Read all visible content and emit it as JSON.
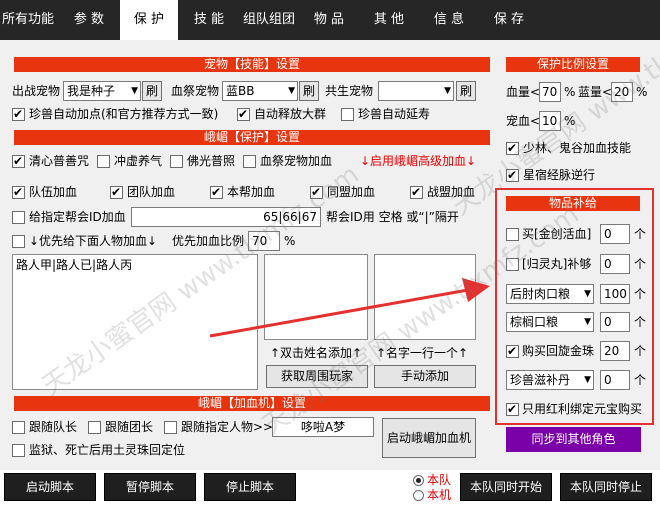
{
  "tabs": [
    "所有功能",
    "参 数",
    "保 护",
    "技 能",
    "组队组团",
    "物 品",
    "其 他",
    "信 息",
    "保 存"
  ],
  "active_tab": "保 护",
  "pet": {
    "header": "宠物【技能】设置",
    "battle_pet_label": "出战宠物",
    "battle_pet_value": "我是种子",
    "blood_pet_label": "血祭宠物",
    "blood_pet_value": "蓝BB",
    "cobirth_pet_label": "共生宠物",
    "cobirth_pet_value": "",
    "refresh_label": "刷",
    "auto_addpoint": "珍兽自动加点(和官方推荐方式一致)",
    "auto_release_group": "自动释放大群",
    "auto_extend": "珍兽自动延寿"
  },
  "protect": {
    "header": "峨嵋【保护】设置",
    "items": [
      "清心普善咒",
      "冲虚养气",
      "佛光普照",
      "血祭宠物加血"
    ],
    "emei_advanced": "↓启用峨嵋高级加血↓",
    "heal_items": [
      "队伍加血",
      "团队加血",
      "本帮加血",
      "同盟加血",
      "战盟加血"
    ],
    "guild_id_label": "给指定帮会ID加血",
    "guild_id_value": "65|66|67",
    "guild_id_hint": "帮会ID用 空格 或“|”隔开",
    "priority_label": "↓优先给下面人物加血↓",
    "priority_ratio_label": "优先加血比例",
    "priority_ratio_value": "70",
    "percent": "%",
    "names_text": "路人甲|路人已|路人丙",
    "double_click_hint": "↑双击姓名添加↑",
    "one_per_line_hint": "↑名字一行一个↑",
    "get_players_btn": "获取周围玩家",
    "manual_add_btn": "手动添加"
  },
  "addmachine": {
    "header": "峨嵋【加血机】设置",
    "follow_leader": "跟随队长",
    "follow_group_leader": "跟随团长",
    "follow_person": "跟随指定人物>>>",
    "follow_person_value": "哆啦A梦",
    "prison_label": "监狱、死亡后用土灵珠回定位",
    "start_btn": "启动峨嵋加血机"
  },
  "ratio": {
    "header": "保护比例设置",
    "hp_label": "血量<",
    "hp_value": "70",
    "mp_label": "蓝量<",
    "mp_value": "20",
    "pet_label": "宠血<",
    "pet_value": "10",
    "percent": "%",
    "shaolin_label": "少林、鬼谷加血技能",
    "star_label": "星宿经脉逆行"
  },
  "supply": {
    "header": "物品补给",
    "rows": [
      {
        "type": "checkbox",
        "label": "买[金创活血]",
        "qty": "0"
      },
      {
        "type": "checkbox",
        "label": "[归灵丸]补够",
        "qty": "0"
      },
      {
        "type": "select",
        "label": "后肘肉口粮",
        "qty": "100"
      },
      {
        "type": "select",
        "label": "棕榈口粮",
        "qty": "0"
      },
      {
        "type": "checkbox",
        "label": "购买回旋金珠",
        "qty": "20"
      },
      {
        "type": "select",
        "label": "珍兽滋补丹",
        "qty": "0"
      }
    ],
    "unit": "个",
    "bind_label": "只用红利绑定元宝购买",
    "sync_btn": "同步到其他角色"
  },
  "bottom": {
    "start": "启动脚本",
    "pause": "暂停脚本",
    "stop": "停止脚本",
    "radio_team": "本队",
    "radio_machine": "本机",
    "team_start": "本队同时开始",
    "team_stop": "本队同时停止"
  },
  "watermark": "天龙小蜜官网 www.tlxmfz.com"
}
